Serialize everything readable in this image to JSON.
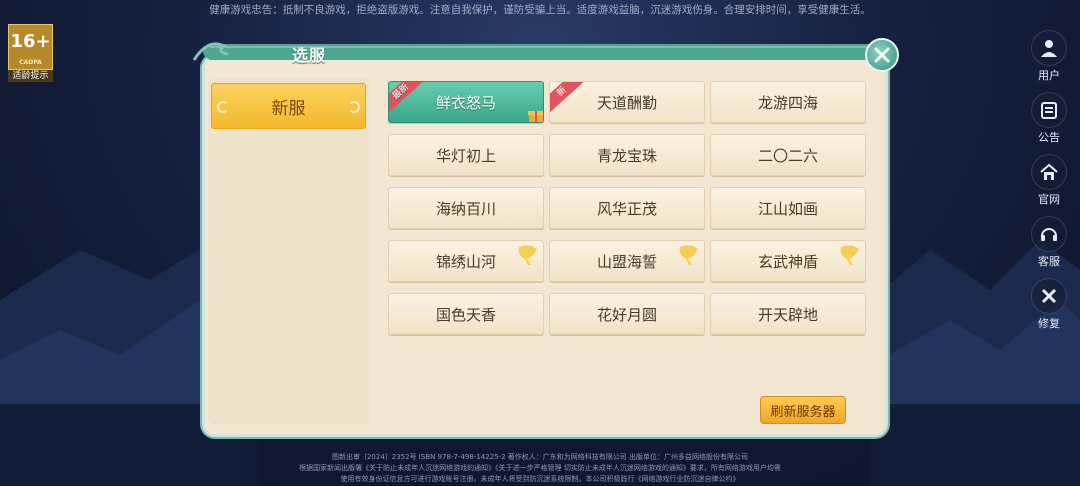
{
  "health_notice": "健康游戏忠告：抵制不良游戏，拒绝盗版游戏。注意自我保护，谨防受骗上当。适度游戏益脑，沉迷游戏伤身。合理安排时间，享受健康生活。",
  "age_badge": {
    "rating": "16+",
    "sub": "CADPA",
    "caption": "适龄提示"
  },
  "side_menu": [
    {
      "label": "用户",
      "icon": "user-icon"
    },
    {
      "label": "公告",
      "icon": "notice-icon"
    },
    {
      "label": "官网",
      "icon": "home-icon"
    },
    {
      "label": "客服",
      "icon": "headset-icon"
    },
    {
      "label": "修复",
      "icon": "repair-icon"
    }
  ],
  "dialog": {
    "title": "选服",
    "tab_label": "新服",
    "refresh_label": "刷新服务器"
  },
  "servers": [
    {
      "name": "鲜衣怒马",
      "ribbon": "最新",
      "selected": true,
      "gift": true
    },
    {
      "name": "天道酬勤",
      "ribbon": "新"
    },
    {
      "name": "龙游四海"
    },
    {
      "name": "华灯初上"
    },
    {
      "name": "青龙宝珠"
    },
    {
      "name": "二〇二六"
    },
    {
      "name": "海纳百川"
    },
    {
      "name": "风华正茂"
    },
    {
      "name": "江山如画"
    },
    {
      "name": "锦绣山河",
      "leaf": true
    },
    {
      "name": "山盟海誓",
      "leaf": true
    },
    {
      "name": "玄武神盾",
      "leaf": true
    },
    {
      "name": "国色天香"
    },
    {
      "name": "花好月圆"
    },
    {
      "name": "开天辟地"
    }
  ],
  "footer": {
    "line1": "图新出审〔2024〕2352号  ISBN 978-7-498-14225-2  著作权人：广东和为网络科技有限公司  出版单位：广州多益网络股份有限公司",
    "line2": "根据国家新闻出版署《关于防止未成年人沉迷网络游戏的通知》《关于进一步严格管理 切实防止未成年人沉迷网络游戏的通知》要求，所有网络游戏用户均需",
    "line3": "使用有效身份证信息方可进行游戏账号注册。未成年人将受到防沉迷系统限制。本公司积极践行《网络游戏行业防沉迷自律公约》"
  },
  "colors": {
    "accent_green": "#3aa88a",
    "tab_gold": "#f3b830",
    "ribbon_red": "#e2545d",
    "panel_bg": "#f3e7d3"
  }
}
